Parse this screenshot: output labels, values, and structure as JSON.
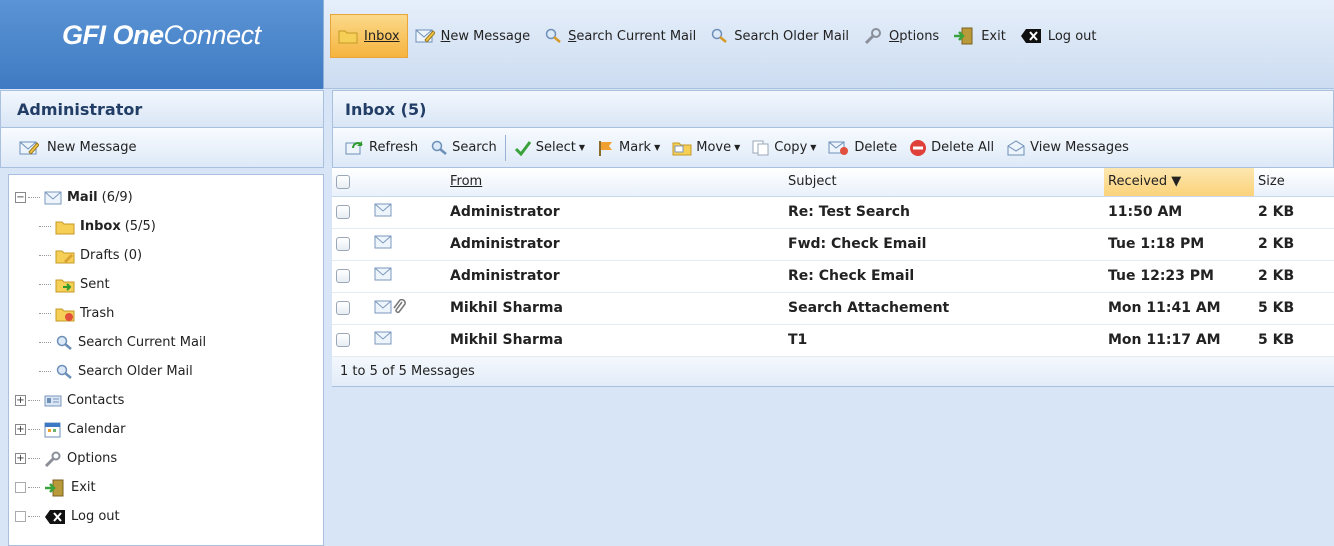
{
  "logo": {
    "part1": "GFI ",
    "part2": "One",
    "part3": "Connect"
  },
  "topnav": [
    {
      "u": "I",
      "rest": "nbox",
      "pre": "",
      "active": true
    },
    {
      "u": "N",
      "rest": "ew Message",
      "pre": ""
    },
    {
      "u": "S",
      "rest": "earch Current Mail",
      "pre": ""
    },
    {
      "u": "",
      "rest": "Search Older Mail",
      "pre": ""
    },
    {
      "u": "O",
      "rest": "ptions",
      "pre": ""
    },
    {
      "u": "",
      "rest": "Exit",
      "pre": ""
    },
    {
      "u": "",
      "rest": "Log out",
      "pre": ""
    }
  ],
  "left": {
    "header": "Administrator",
    "new_message": "New Message",
    "tree": {
      "mail": {
        "label": "Mail",
        "count": "(6/9)"
      },
      "inbox": {
        "label": "Inbox",
        "count": "(5/5)"
      },
      "drafts": "Drafts (0)",
      "sent": "Sent",
      "trash": "Trash",
      "search_current": "Search Current Mail",
      "search_older": "Search Older Mail",
      "contacts": "Contacts",
      "calendar": "Calendar",
      "options": "Options",
      "exit": "Exit",
      "logout": "Log out"
    }
  },
  "main": {
    "header": "Inbox (5)",
    "toolbar": {
      "refresh": "Refresh",
      "search": "Search",
      "select": "Select",
      "mark": "Mark",
      "move": "Move",
      "copy": "Copy",
      "delete": "Delete",
      "delete_all": "Delete All",
      "view_messages": "View Messages"
    },
    "columns": {
      "from": "From",
      "subject": "Subject",
      "received": "Received ▼",
      "size": "Size"
    },
    "rows": [
      {
        "from": "Administrator",
        "subject": "Re: Test Search",
        "received": "11:50 AM",
        "size": "2 KB",
        "attach": false
      },
      {
        "from": "Administrator",
        "subject": "Fwd: Check Email",
        "received": "Tue 1:18 PM",
        "size": "2 KB",
        "attach": false
      },
      {
        "from": "Administrator",
        "subject": "Re: Check Email",
        "received": "Tue 12:23 PM",
        "size": "2 KB",
        "attach": false
      },
      {
        "from": "Mikhil Sharma",
        "subject": "Search Attachement",
        "received": "Mon 11:41 AM",
        "size": "5 KB",
        "attach": true
      },
      {
        "from": "Mikhil Sharma",
        "subject": "T1",
        "received": "Mon 11:17 AM",
        "size": "5 KB",
        "attach": false
      }
    ],
    "footer": "1 to 5 of 5 Messages"
  },
  "colors": {
    "accent": "#f6b43e",
    "header_text": "#233e66",
    "logo_bg": "#4a85cb"
  }
}
